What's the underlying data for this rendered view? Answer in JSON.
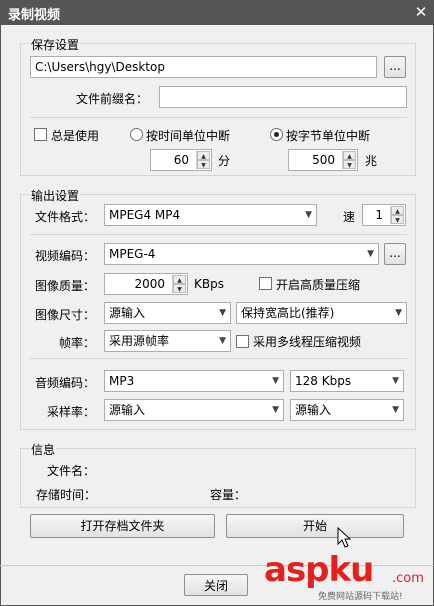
{
  "window": {
    "title": "录制视频",
    "close_glyph": "✕"
  },
  "save": {
    "group_title": "保存设置",
    "path": "C:\\Users\\hgy\\Desktop",
    "browse_label": "...",
    "prefix_label": "文件前缀名：",
    "prefix_value": "",
    "always_use_label": "总是使用",
    "time_split_label": "按时间单位中断",
    "byte_split_label": "按字节单位中断",
    "time_value": "60",
    "time_unit": "分",
    "byte_value": "500",
    "byte_unit": "兆"
  },
  "output": {
    "group_title": "输出设置",
    "format_label": "文件格式：",
    "format_value": "MPEG4 MP4",
    "speed_label": "速",
    "speed_value": "1",
    "video_codec_label": "视频编码：",
    "video_codec_value": "MPEG-4",
    "video_codec_btn": "...",
    "quality_label": "图像质量：",
    "quality_value": "2000",
    "quality_unit": "KBps",
    "hq_compress_label": "开启高质量压缩",
    "size_label": "图像尺寸：",
    "size_value": "源输入",
    "aspect_value": "保持宽高比(推荐)",
    "fps_label": "帧率：",
    "fps_value": "采用源帧率",
    "multithread_label": "采用多线程压缩视频",
    "audio_codec_label": "音频编码：",
    "audio_codec_value": "MP3",
    "audio_bitrate_value": "128 Kbps",
    "samplerate_label": "采样率：",
    "samplerate_value": "源输入",
    "channels_value": "源输入"
  },
  "info": {
    "group_title": "信息",
    "filename_label": "文件名：",
    "duration_label": "存储时间：",
    "size_label": "容量："
  },
  "actions": {
    "open_folder_label": "打开存档文件夹",
    "start_label": "开始",
    "close_label": "关闭"
  },
  "watermark": {
    "main": "aspku",
    "dot": ".com",
    "sub": "免费网站源码下载站!"
  },
  "colors": {
    "titlebar": "#555555",
    "watermark": "#e0231f"
  }
}
